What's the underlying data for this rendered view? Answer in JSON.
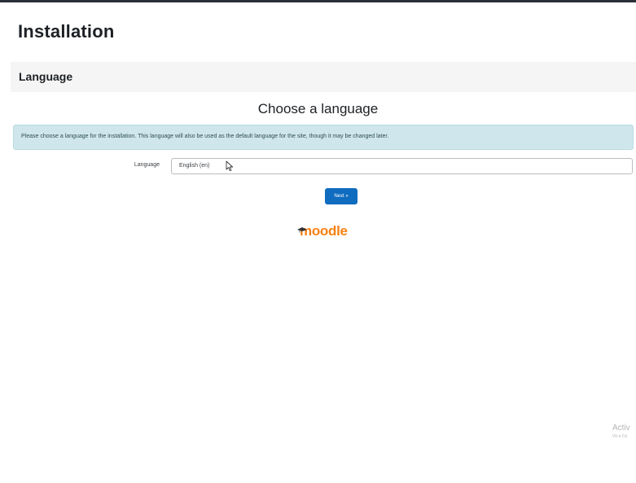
{
  "header": {
    "title": "Installation"
  },
  "section": {
    "title": "Language"
  },
  "main": {
    "heading": "Choose a language",
    "info": "Please choose a language for the installation. This language will also be used as the default language for the site, though it may be changed later.",
    "language_label": "Language",
    "language_value": "English (en)",
    "next_label": "Next »"
  },
  "logo": {
    "text": "moodle",
    "color": "#f98012"
  },
  "watermark": {
    "title": "Activ",
    "subtitle": "Vè a Cà"
  },
  "colors": {
    "accent": "#0f6cbf",
    "info_background": "#cfe7ec",
    "section_background": "#f5f5f5"
  }
}
